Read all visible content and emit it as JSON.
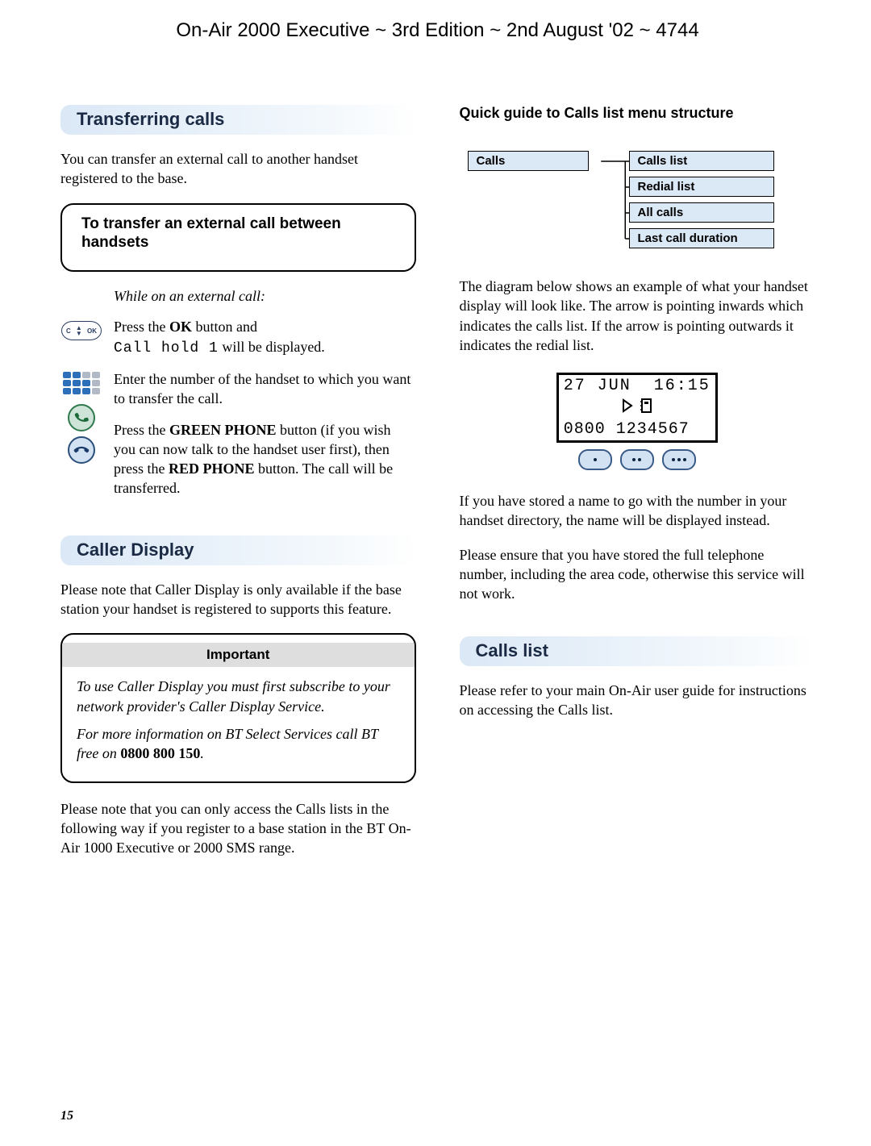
{
  "header": "On-Air 2000 Executive ~ 3rd Edition ~ 2nd August '02 ~ 4744",
  "left": {
    "h1": "Transferring calls",
    "p1": "You can transfer an external call to another handset registered to the base.",
    "callout1_head": "To transfer an external call between handsets",
    "step_lead": "While on an external call:",
    "step1_a": "Press the ",
    "step1_b": "OK",
    "step1_c": " button and ",
    "step1_mono": "Call hold 1",
    "step1_d": " will be displayed.",
    "step2": "Enter the number of the handset to which you want to transfer the call.",
    "step3_a": "Press the ",
    "step3_b": "GREEN PHONE",
    "step3_c": " button (if you wish you can now talk to the handset user first), then press the ",
    "step3_d": "RED PHONE",
    "step3_e": " button. The call will be transferred.",
    "h2": "Caller Display",
    "cd_p1": "Please note that Caller Display is only available if the base station your handset is registered to supports this feature.",
    "imp_title": "Important",
    "imp_p1": "To use Caller Display you must first subscribe to your network provider's Caller Display Service.",
    "imp_p2_a": "For more information on BT Select Services call BT free on ",
    "imp_p2_b": "0800 800 150",
    "imp_p2_c": ".",
    "cd_p2": "Please note that you can only access the Calls lists in the following way if you register to a base station in the BT On-Air 1000 Executive or 2000 SMS range."
  },
  "right": {
    "qg_title": "Quick guide to Calls list menu structure",
    "tree_root": "Calls",
    "tree_items": [
      "Calls list",
      "Redial list",
      "All calls",
      "Last call duration"
    ],
    "diag_p": "The diagram below shows an example of what your handset display will look like. The arrow is pointing inwards which indicates the calls list. If the arrow is pointing outwards it indicates the redial list.",
    "hs_date": "27 JUN",
    "hs_time": "16:15",
    "hs_number": "0800 1234567",
    "stored_p": "If you have stored a name to go with the number in your handset directory, the name will be displayed instead.",
    "ensure_p": "Please ensure that you have stored the full telephone number, including the area code, otherwise this service will not work.",
    "h3": "Calls list",
    "cl_p": "Please refer to your main On-Air user guide for instructions on accessing the Calls list."
  },
  "page_number": "15"
}
